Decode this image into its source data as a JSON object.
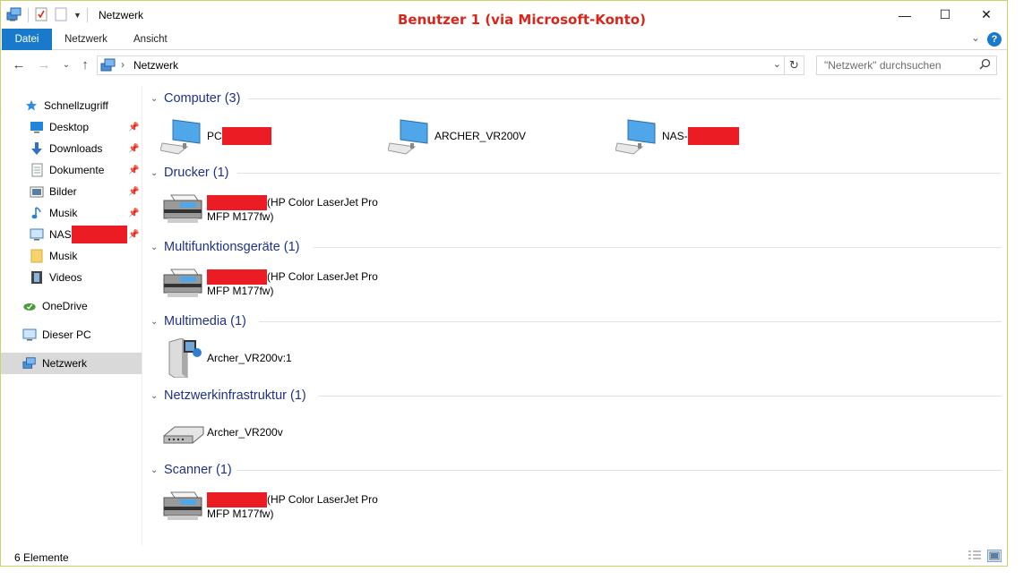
{
  "window": {
    "title": "Netzwerk",
    "annotation": "Benutzer 1 (via Microsoft-Konto)",
    "controls": {
      "minimize": "—",
      "maximize": "☐",
      "close": "✕"
    }
  },
  "ribbon": {
    "tabs": [
      "Datei",
      "Netzwerk",
      "Ansicht"
    ],
    "help_label": "?"
  },
  "nav": {
    "address": "Netzwerk",
    "search_placeholder": "\"Netzwerk\" durchsuchen"
  },
  "sidebar": {
    "items": [
      {
        "label": "Schnellzugriff",
        "icon": "star-icon"
      },
      {
        "label": "Desktop",
        "icon": "desktop-icon",
        "pinned": true
      },
      {
        "label": "Downloads",
        "icon": "download-icon",
        "pinned": true
      },
      {
        "label": "Dokumente",
        "icon": "document-icon",
        "pinned": true
      },
      {
        "label": "Bilder",
        "icon": "pictures-icon",
        "pinned": true
      },
      {
        "label": "Musik",
        "icon": "music-icon",
        "pinned": true
      },
      {
        "label": "NAS",
        "icon": "monitor-icon",
        "pinned": true,
        "redacted": true
      },
      {
        "label": "Musik",
        "icon": "folder-icon"
      },
      {
        "label": "Videos",
        "icon": "video-icon"
      },
      {
        "label": "OneDrive",
        "icon": "onedrive-icon"
      },
      {
        "label": "Dieser PC",
        "icon": "pc-icon"
      },
      {
        "label": "Netzwerk",
        "icon": "network-icon",
        "selected": true
      }
    ]
  },
  "groups": [
    {
      "header": "Computer (3)",
      "items": [
        {
          "label": "PC",
          "icon": "computer-icon",
          "redacted": true
        },
        {
          "label": "ARCHER_VR200V",
          "icon": "computer-icon"
        },
        {
          "label": "NAS-",
          "icon": "computer-icon",
          "redacted": true
        }
      ]
    },
    {
      "header": "Drucker (1)",
      "items": [
        {
          "label_line1": "(HP Color LaserJet Pro",
          "label_line2": "MFP M177fw)",
          "icon": "printer-icon",
          "redacted": true
        }
      ]
    },
    {
      "header": "Multifunktionsgeräte (1)",
      "items": [
        {
          "label_line1": "(HP Color LaserJet Pro",
          "label_line2": "MFP M177fw)",
          "icon": "printer-icon",
          "redacted": true
        }
      ]
    },
    {
      "header": "Multimedia (1)",
      "items": [
        {
          "label": "Archer_VR200v:1",
          "icon": "media-server-icon"
        }
      ]
    },
    {
      "header": "Netzwerkinfrastruktur (1)",
      "items": [
        {
          "label": "Archer_VR200v",
          "icon": "router-icon"
        }
      ]
    },
    {
      "header": "Scanner (1)",
      "items": [
        {
          "label_line1": "(HP Color LaserJet Pro",
          "label_line2": "MFP M177fw)",
          "icon": "printer-icon",
          "redacted": true
        }
      ]
    }
  ],
  "status": {
    "count": "6 Elemente"
  },
  "colors": {
    "accent": "#1979ca",
    "group_header": "#1e3287",
    "redaction": "#ec1c24",
    "annotation": "#d9261c"
  }
}
